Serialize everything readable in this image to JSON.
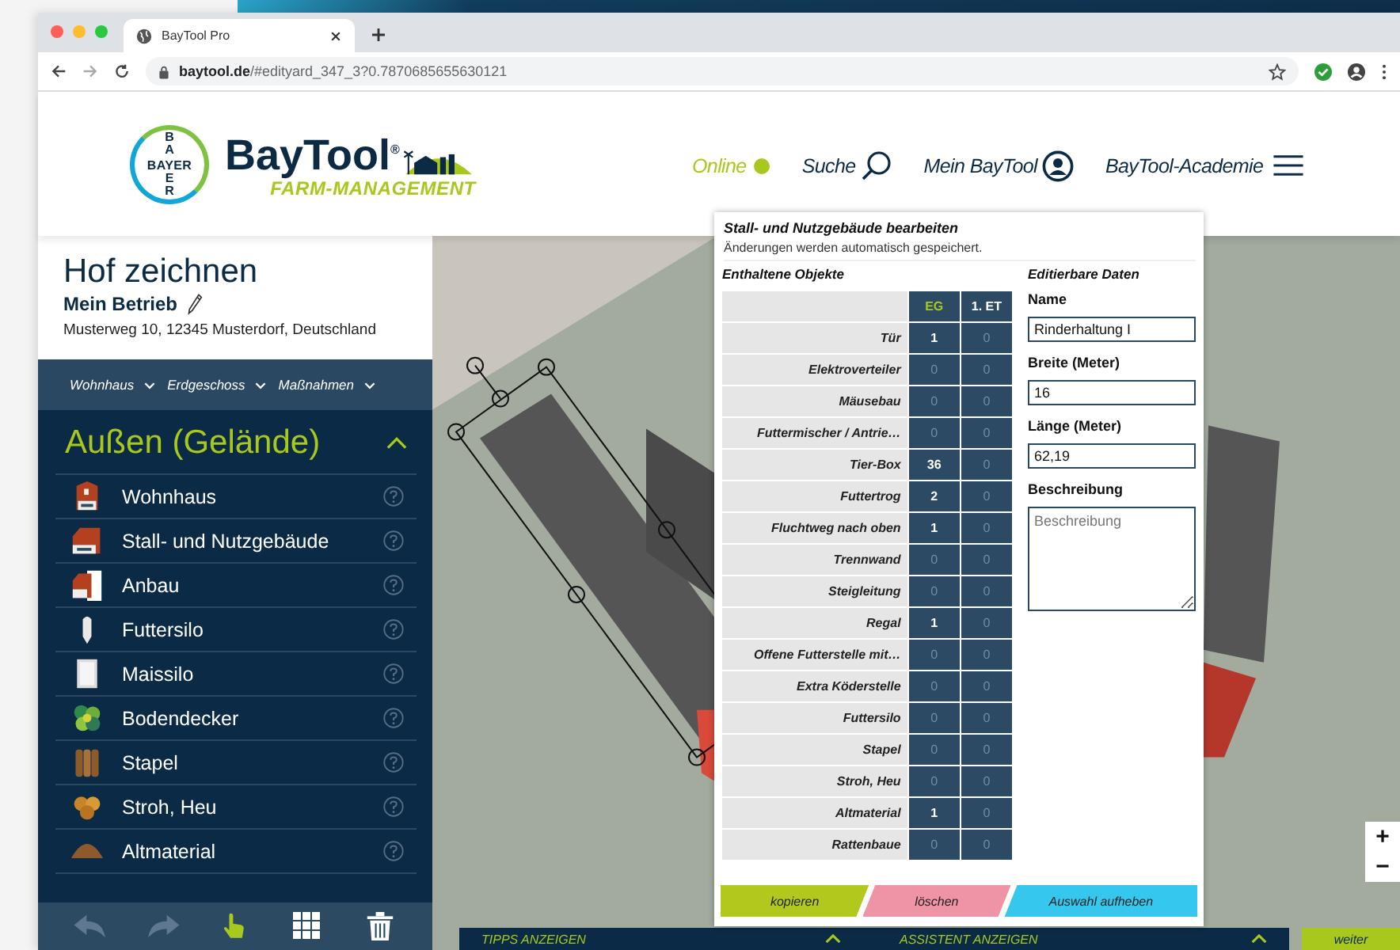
{
  "browser": {
    "tab_title": "BayTool Pro",
    "url": "**baytool.de**/#edityard_347_3?0.7870685655630121",
    "ok_status": true
  },
  "header": {
    "logo": {
      "horizontal": "BAYER",
      "top": "BA",
      "bottom": "ER"
    },
    "brand": "BayTool$^{®}$",
    "tagline": "FARM-MANAGEMENT",
    "nav": [
      {
        "kind": "status",
        "label": "Online",
        "on": true
      },
      {
        "kind": "search",
        "label": "Suche"
      },
      {
        "kind": "account",
        "label": "Mein BayTool"
      },
      {
        "kind": "menu",
        "label": "BayTool-Academie"
      }
    ]
  },
  "sidebar": {
    "title": "Hof zeichnen",
    "farm_name": "Mein Betrieb",
    "address": "Musterweg 10, 12345 Musterdorf, Deutschland",
    "filters": [
      "Wohnhaus",
      "Erdgeschoss",
      "Maßnahmen"
    ],
    "section": {
      "title": "Außen (Gelände)",
      "expanded": true
    },
    "items": [
      {
        "kind": "house",
        "label": "Wohnhaus"
      },
      {
        "kind": "barn",
        "label": "Stall- und Nutzgebäude"
      },
      {
        "kind": "annex",
        "label": "Anbau"
      },
      {
        "kind": "silo",
        "label": "Futtersilo"
      },
      {
        "kind": "bunker",
        "label": "Maissilo"
      },
      {
        "kind": "shrub",
        "label": "Bodendecker"
      },
      {
        "kind": "logs",
        "label": "Stapel"
      },
      {
        "kind": "straw",
        "label": "Stroh, Heu"
      },
      {
        "kind": "heap",
        "label": "Altmaterial"
      }
    ],
    "tools": [
      {
        "kind": "undo",
        "selected": false
      },
      {
        "kind": "redo",
        "selected": false
      },
      {
        "kind": "pointer",
        "selected": true
      },
      {
        "kind": "grid",
        "selected": false
      },
      {
        "kind": "trash",
        "selected": false
      }
    ]
  },
  "dialog": {
    "title": "Stall- und Nutzgebäude bearbeiten",
    "note": "Änderungen werden automatisch gespeichert.",
    "objects_heading": "Enthaltene Objekte",
    "data_heading": "Editierbare Daten",
    "columns": [
      {
        "label": "EG",
        "selected": true
      },
      {
        "label": "1. ET",
        "selected": false
      }
    ],
    "rows": [
      {
        "label": "Tür",
        "values": [
          "1",
          "0"
        ]
      },
      {
        "label": "Elektroverteiler",
        "values": [
          "0",
          "0"
        ]
      },
      {
        "label": "Mäusebau",
        "values": [
          "0",
          "0"
        ]
      },
      {
        "label": "Futtermischer / Antrie…",
        "values": [
          "0",
          "0"
        ]
      },
      {
        "label": "Tier-Box",
        "values": [
          "36",
          "0"
        ]
      },
      {
        "label": "Futtertrog",
        "values": [
          "2",
          "0"
        ]
      },
      {
        "label": "Fluchtweg nach oben",
        "values": [
          "1",
          "0"
        ]
      },
      {
        "label": "Trennwand",
        "values": [
          "0",
          "0"
        ]
      },
      {
        "label": "Steigleitung",
        "values": [
          "0",
          "0"
        ]
      },
      {
        "label": "Regal",
        "values": [
          "1",
          "0"
        ]
      },
      {
        "label": "Offene Futterstelle mit…",
        "values": [
          "0",
          "0"
        ]
      },
      {
        "label": "Extra Köderstelle",
        "values": [
          "0",
          "0"
        ]
      },
      {
        "label": "Futtersilo",
        "values": [
          "0",
          "0"
        ]
      },
      {
        "label": "Stapel",
        "values": [
          "0",
          "0"
        ]
      },
      {
        "label": "Stroh, Heu",
        "values": [
          "0",
          "0"
        ]
      },
      {
        "label": "Altmaterial",
        "values": [
          "1",
          "0"
        ]
      },
      {
        "label": "Rattenbaue",
        "values": [
          "0",
          "0"
        ]
      }
    ],
    "fields": [
      {
        "kind": "input",
        "label": "Name",
        "value": "Rinderhaltung I"
      },
      {
        "kind": "input",
        "label": "Breite (Meter)",
        "value": "16"
      },
      {
        "kind": "input",
        "label": "Länge (Meter)",
        "value": "62,19"
      },
      {
        "kind": "textarea",
        "label": "Beschreibung",
        "placeholder": "Beschreibung"
      }
    ],
    "buttons": [
      {
        "label": "kopieren",
        "color": "#b3c81c"
      },
      {
        "label": "löschen",
        "color": "#ef93a6"
      },
      {
        "label": "Auswahl aufheben",
        "color": "#35c7ee"
      }
    ]
  },
  "bottom_bar": {
    "tips": "TIPPS ANZEIGEN",
    "assistant": "ASSISTENT ANZEIGEN",
    "next": "weiter"
  },
  "zoom": {
    "in": "+",
    "out": "−"
  }
}
